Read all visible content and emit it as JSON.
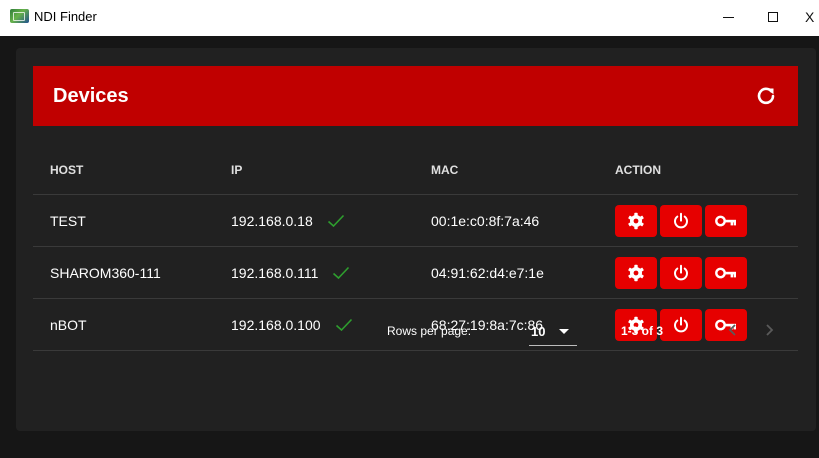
{
  "window": {
    "title": "NDI Finder",
    "close_glyph": "X"
  },
  "header": {
    "title": "Devices",
    "refresh_icon": "refresh-icon"
  },
  "table": {
    "columns": [
      "HOST",
      "IP",
      "MAC",
      "ACTION"
    ],
    "rows": [
      {
        "host": "TEST",
        "ip": "192.168.0.18",
        "mac": "00:1e:c0:8f:7a:46",
        "online": true
      },
      {
        "host": "SHAROM360-111",
        "ip": "192.168.0.111",
        "mac": "04:91:62:d4:e7:1e",
        "online": true
      },
      {
        "host": "nBOT",
        "ip": "192.168.0.100",
        "mac": "68:27:19:8a:7c:86",
        "online": true
      }
    ],
    "action_icons": [
      "gear-icon",
      "power-icon",
      "key-icon"
    ]
  },
  "pagination": {
    "rows_per_page_label": "Rows per page:",
    "rows_per_page_value": "10",
    "range_text": "1-3 of 3"
  },
  "colors": {
    "header_bg": "#c00000",
    "action_button": "#e60000",
    "check": "#2e9e2e",
    "surface": "#212121",
    "background": "#161616"
  }
}
